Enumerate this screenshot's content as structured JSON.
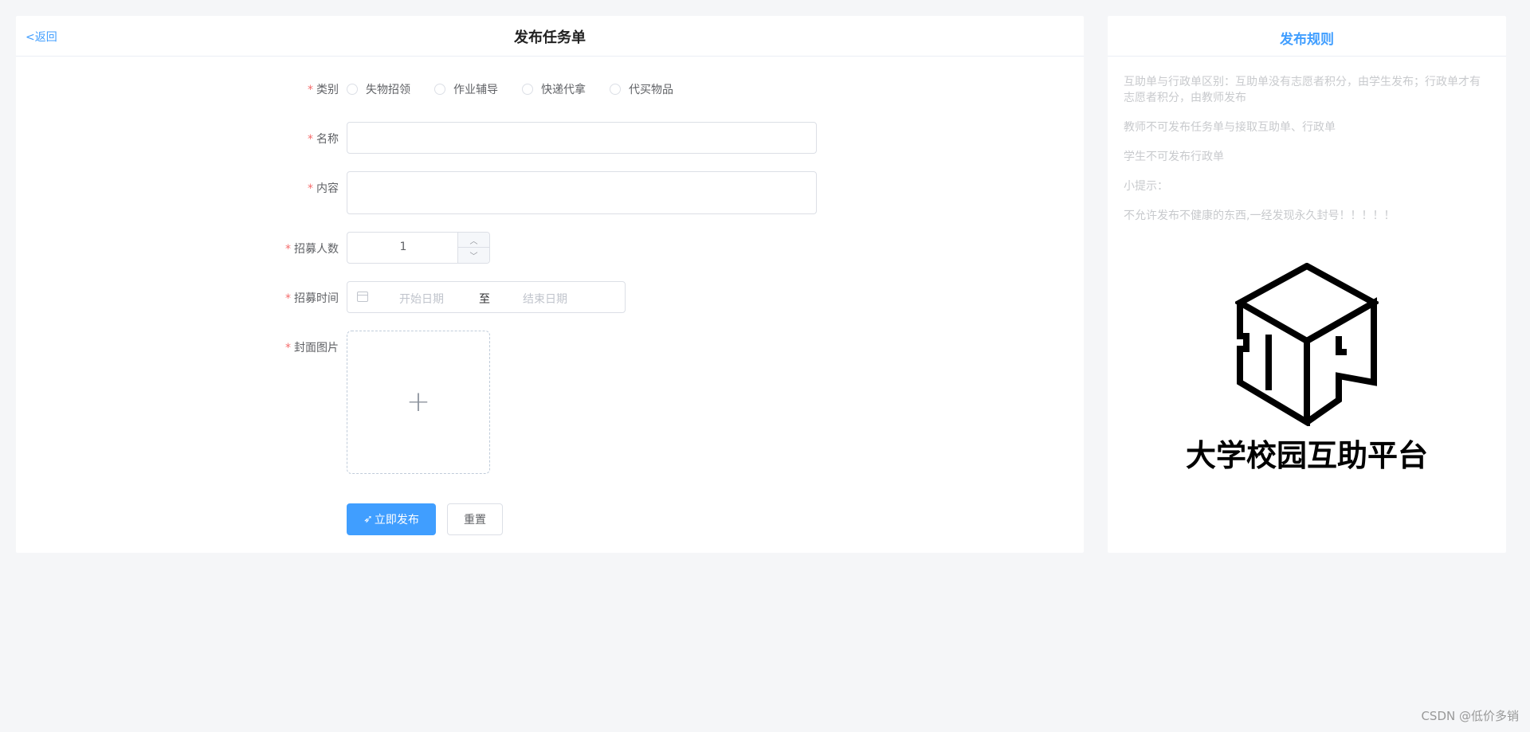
{
  "header": {
    "back_label": "<返回",
    "title": "发布任务单"
  },
  "form": {
    "category": {
      "label": "类别",
      "options": [
        "失物招领",
        "作业辅导",
        "快递代拿",
        "代买物品"
      ]
    },
    "name": {
      "label": "名称",
      "value": ""
    },
    "content": {
      "label": "内容",
      "value": ""
    },
    "recruit_count": {
      "label": "招募人数",
      "value": "1"
    },
    "recruit_time": {
      "label": "招募时间",
      "start_placeholder": "开始日期",
      "separator": "至",
      "end_placeholder": "结束日期"
    },
    "cover": {
      "label": "封面图片"
    },
    "submit_label": "立即发布",
    "reset_label": "重置"
  },
  "side": {
    "title": "发布规则",
    "rules": [
      "互助单与行政单区别：互助单没有志愿者积分，由学生发布；行政单才有志愿者积分，由教师发布",
      "教师不可发布任务单与接取互助单、行政单",
      "学生不可发布行政单",
      "小提示：",
      "不允许发布不健康的东西,一经发现永久封号！！！！！"
    ],
    "logo_text": "大学校园互助平台"
  },
  "watermark": "CSDN @低价多销",
  "colors": {
    "primary": "#409eff",
    "required": "#f56c6c",
    "background": "#f5f6f8"
  }
}
